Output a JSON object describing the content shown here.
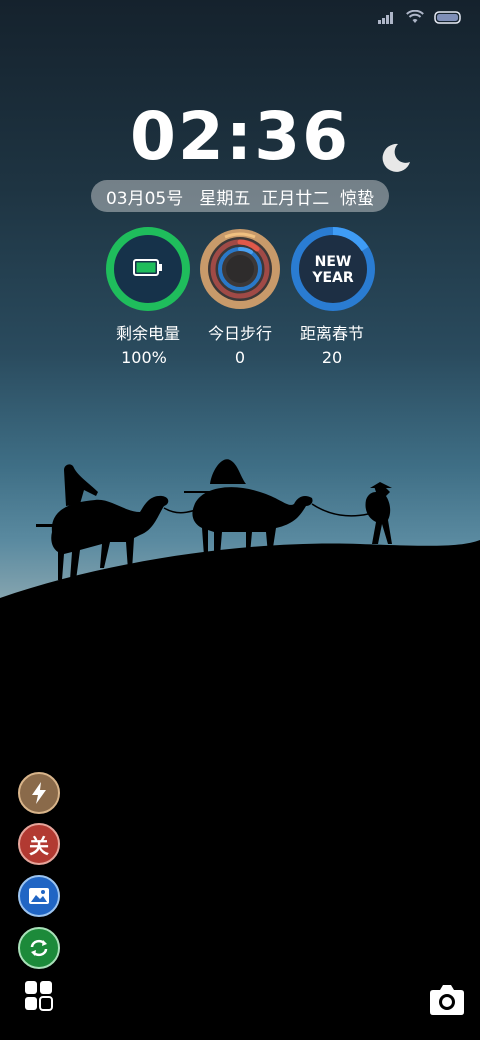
{
  "clock": {
    "time": "02:36"
  },
  "date_bar": {
    "date": "03月05号",
    "weekday": "星期五",
    "lunar": "正月廿二",
    "solar_term": "惊蛰"
  },
  "widgets": [
    {
      "label": "剩余电量",
      "value": "100%",
      "icon": "battery-icon",
      "ring_color": "#1fbd5c",
      "level": 1.0
    },
    {
      "label": "今日步行",
      "value": "0",
      "icon": "activity-rings-icon",
      "ring_color": "#c89a6a",
      "level": 0
    },
    {
      "label": "距离春节",
      "value": "20",
      "icon": "new-year-icon",
      "badge_text": [
        "NEW",
        "YEAR"
      ],
      "ring_color": "#2a7cd2"
    }
  ],
  "side_buttons": [
    {
      "name": "flash-button",
      "icon": "lightning-icon",
      "color": "#8a6a4a"
    },
    {
      "name": "off-button",
      "glyph": "关",
      "icon": "off-icon",
      "color": "#b23a32"
    },
    {
      "name": "gallery-button",
      "icon": "image-icon",
      "color": "#2065c4"
    },
    {
      "name": "rotate-button",
      "icon": "refresh-icon",
      "color": "#1c8a3a"
    }
  ],
  "bottom": {
    "left_icon": "apps-icon",
    "right_icon": "camera-icon"
  },
  "status_bar": {
    "signal_icon": "signal-icon",
    "wifi_icon": "wifi-icon",
    "battery_icon": "battery-status-icon"
  }
}
